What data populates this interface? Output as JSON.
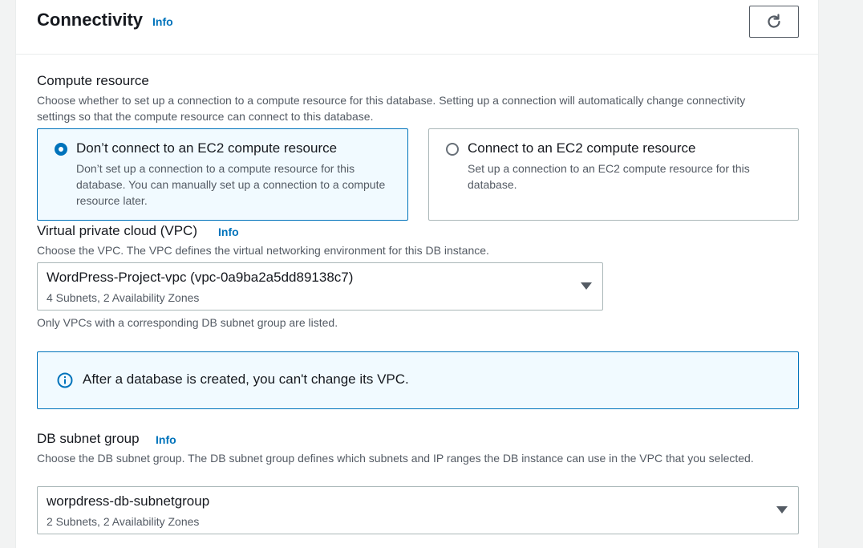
{
  "section": {
    "title": "Connectivity",
    "info": "Info",
    "refresh_icon": "refresh-icon"
  },
  "compute": {
    "label": "Compute resource",
    "description": "Choose whether to set up a connection to a compute resource for this database. Setting up a connection will automatically change connectivity settings so that the compute resource can connect to this database.",
    "options": [
      {
        "title": "Don’t connect to an EC2 compute resource",
        "description": "Don’t set up a connection to a compute resource for this database. You can manually set up a connection to a compute resource later.",
        "selected": true
      },
      {
        "title": "Connect to an EC2 compute resource",
        "description": "Set up a connection to an EC2 compute resource for this database.",
        "selected": false
      }
    ]
  },
  "vpc": {
    "label": "Virtual private cloud (VPC)",
    "info": "Info",
    "description": "Choose the VPC. The VPC defines the virtual networking environment for this DB instance.",
    "value": "WordPress-Project-vpc (vpc-0a9ba2a5dd89138c7)",
    "sub": "4 Subnets, 2 Availability Zones",
    "hint": "Only VPCs with a corresponding DB subnet group are listed."
  },
  "alert": {
    "icon": "info-circle-icon",
    "text": "After a database is created, you can't change its VPC."
  },
  "subnet": {
    "label": "DB subnet group",
    "info": "Info",
    "description": "Choose the DB subnet group. The DB subnet group defines which subnets and IP ranges the DB instance can use in the VPC that you selected.",
    "value": "worpdress-db-subnetgroup",
    "sub": "2 Subnets, 2 Availability Zones"
  },
  "colors": {
    "accent": "#0073bb",
    "selected_bg": "#f1faff",
    "border": "#aab7b8",
    "text_secondary": "#545b64"
  }
}
